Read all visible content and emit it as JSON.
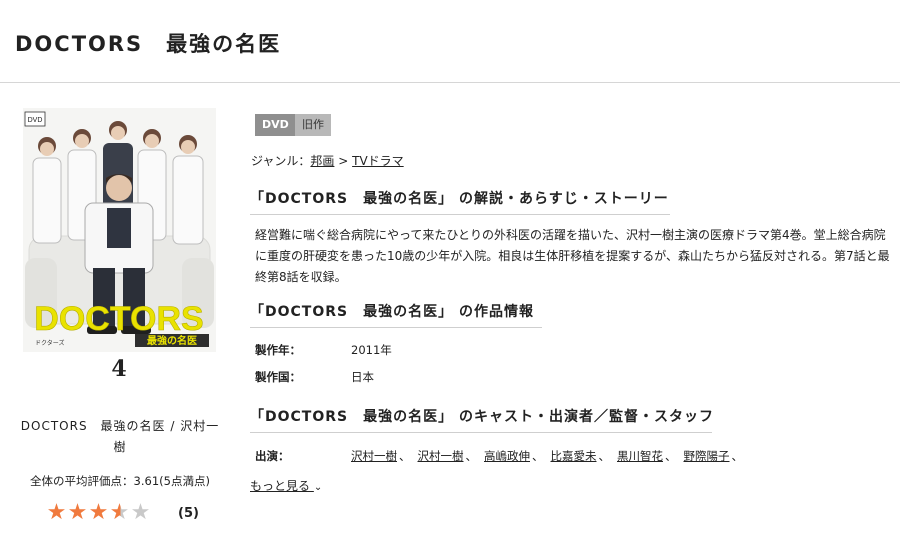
{
  "header": {
    "title": "DOCTORS　最強の名医"
  },
  "cover": {
    "logo_text": "DOCTORS",
    "subtitle_text": "最強の名医",
    "small_caption": "ドクターズ",
    "volume": "4",
    "dvd_mark": "DVD"
  },
  "left": {
    "caption": "DOCTORS　最強の名医 / 沢村一樹",
    "rating_label": "全体の平均評価点：3.61(5点満点)",
    "rating_value": 3.61,
    "rating_max": 5,
    "review_count": "(5)"
  },
  "tags": {
    "dvd": "DVD",
    "old": "旧作"
  },
  "genre": {
    "prefix": "ジャンル：",
    "item1": "邦画",
    "separator": " > ",
    "item2": "TVドラマ"
  },
  "sections": {
    "synopsis_heading": "「DOCTORS　最強の名医」 の解説・あらすじ・ストーリー",
    "synopsis_text": "経営難に喘ぐ総合病院にやって来たひとりの外科医の活躍を描いた、沢村一樹主演の医療ドラマ第4巻。堂上総合病院に重度の肝硬変を患った10歳の少年が入院。相良は生体肝移植を提案するが、森山たちから猛反対される。第7話と最終第8話を収録。",
    "info_heading": "「DOCTORS　最強の名医」 の作品情報",
    "cast_heading": "「DOCTORS　最強の名医」 のキャスト・出演者／監督・スタッフ"
  },
  "info": {
    "year_label": "製作年：",
    "year_value": "2011年",
    "country_label": "製作国：",
    "country_value": "日本"
  },
  "cast": {
    "label": "出演：",
    "members": [
      "沢村一樹",
      "沢村一樹",
      "高嶋政伸",
      "比嘉愛未",
      "黒川智花",
      "野際陽子"
    ],
    "separator": "、"
  },
  "more_link": "もっと見る",
  "colors": {
    "star": "#f07a3e",
    "logo_yellow": "#e9e200",
    "tag_dvd": "#8f8f8f"
  }
}
